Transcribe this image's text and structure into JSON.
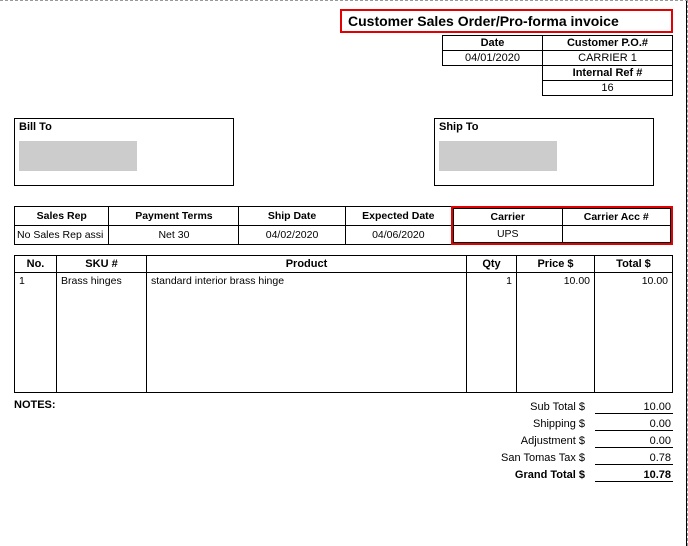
{
  "title": "Customer Sales Order/Pro-forma invoice",
  "header": {
    "date_label": "Date",
    "date": "04/01/2020",
    "po_label": "Customer P.O.#",
    "po": "CARRIER 1",
    "ref_label": "Internal Ref #",
    "ref": "16"
  },
  "bill_to_label": "Bill To",
  "ship_to_label": "Ship To",
  "details": {
    "sales_rep_label": "Sales Rep",
    "sales_rep": "No Sales Rep assi",
    "terms_label": "Payment Terms",
    "terms": "Net 30",
    "ship_date_label": "Ship Date",
    "ship_date": "04/02/2020",
    "expected_label": "Expected Date",
    "expected": "04/06/2020",
    "carrier_label": "Carrier",
    "carrier": "UPS",
    "carrier_acc_label": "Carrier Acc #",
    "carrier_acc": ""
  },
  "columns": {
    "no": "No.",
    "sku": "SKU #",
    "product": "Product",
    "qty": "Qty",
    "price": "Price $",
    "total": "Total $"
  },
  "lines": [
    {
      "no": "1",
      "sku": "Brass hinges",
      "product": "standard interior brass hinge",
      "qty": "1",
      "price": "10.00",
      "total": "10.00"
    }
  ],
  "notes_label": "NOTES:",
  "totals": {
    "subtotal_label": "Sub Total $",
    "subtotal": "10.00",
    "shipping_label": "Shipping $",
    "shipping": "0.00",
    "adjustment_label": "Adjustment $",
    "adjustment": "0.00",
    "tax_label": "San Tomas  Tax $",
    "tax": "0.78",
    "grand_label": "Grand Total $",
    "grand": "10.78"
  }
}
